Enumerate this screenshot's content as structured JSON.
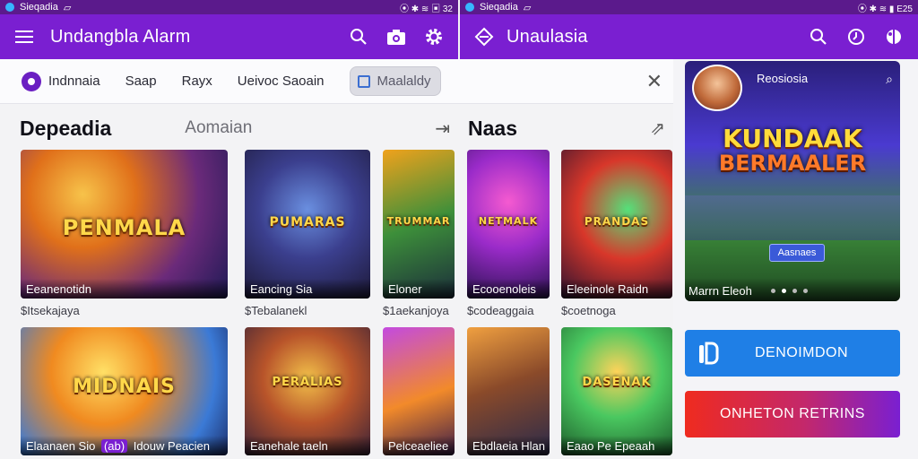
{
  "left_status": {
    "time": "Sieqadia",
    "icons": "⦿ ✱ ≋ ▣ 32"
  },
  "right_status": {
    "time": "Sieqadia",
    "icons": "⦿ ✱ ≋ ▮ E25"
  },
  "left_appbar": {
    "title": "Undangbla Alarm"
  },
  "right_appbar": {
    "title": "Unaulasia"
  },
  "chips": [
    {
      "label": "Indnnaia"
    },
    {
      "label": "Saap"
    },
    {
      "label": "Rayx"
    },
    {
      "label": "Ueivoc Saoain"
    },
    {
      "label": "Maalaldy"
    }
  ],
  "section1": {
    "title": "Depeadia",
    "subtitle": "Aomaian",
    "arrow": "⇥"
  },
  "section2": {
    "title": "Naas",
    "arrow": "⇗"
  },
  "row1": [
    {
      "name": "Eeanenotidn",
      "price": "$Itsekajaya",
      "logo": "PENMALA"
    },
    {
      "name": "Eancing Sia",
      "price": "$Tebalanekl",
      "logo": "PUMARAS"
    },
    {
      "name": "Eloner",
      "price": "$1aekanjoya",
      "logo": "TRUMMAR"
    },
    {
      "name": "Ecooenoleis",
      "price": "$codeaggaia",
      "logo": "NETMALK"
    },
    {
      "name": "Eleeinole Raidn",
      "price": "$coetnoga",
      "logo": "PRANDAS"
    }
  ],
  "row2": [
    {
      "name": "Elaanaen Sio",
      "badge": "(ab)",
      "name2": "Idouw Peacien",
      "logo": "MIDNAIS"
    },
    {
      "name": "Eanehale taeln",
      "logo": "PERALIAS"
    },
    {
      "name": "Pelceaeliee",
      "logo": ""
    },
    {
      "name": "Ebdlaeia Hlan",
      "logo": ""
    },
    {
      "name": "Eaao Pe Epeaah",
      "logo": "DASENAK"
    }
  ],
  "hero": {
    "tag": "Reosiosia",
    "logo_line1": "KUNDAAK",
    "logo_line2": "BERMAALER",
    "button": "Aasnaes",
    "caption": "Marrn Eleoh"
  },
  "buttons": {
    "primary": "DENOIMDON",
    "secondary": "ONHETON RETRINS"
  },
  "colors": {
    "status_bar": "#5b1a8c",
    "app_bar": "#7a1fd1",
    "primary_button": "#1f7fe6",
    "secondary_button_start": "#ef2b1f",
    "secondary_button_end": "#7a1fd1"
  }
}
